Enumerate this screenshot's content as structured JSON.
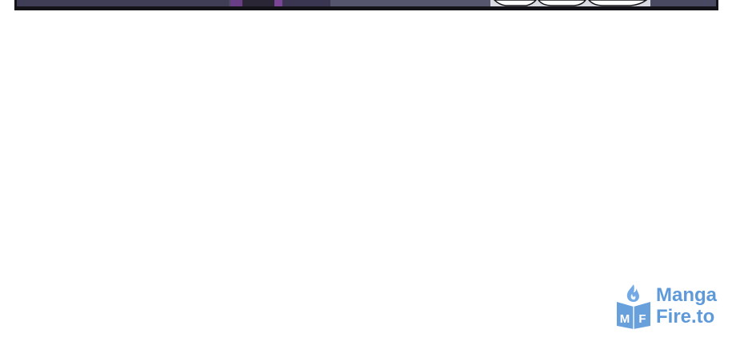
{
  "watermark": {
    "brand": "MangaFire.to",
    "line1": "Manga",
    "line2": "Fire.to",
    "badge_letters": "MF",
    "brand_color": "#4d8fd6",
    "icon": "book-flame-logo-icon"
  },
  "panel": {
    "description_colors": {
      "frame": "#141418",
      "fill": "#4a4962",
      "accent": "#6a3e86"
    }
  }
}
